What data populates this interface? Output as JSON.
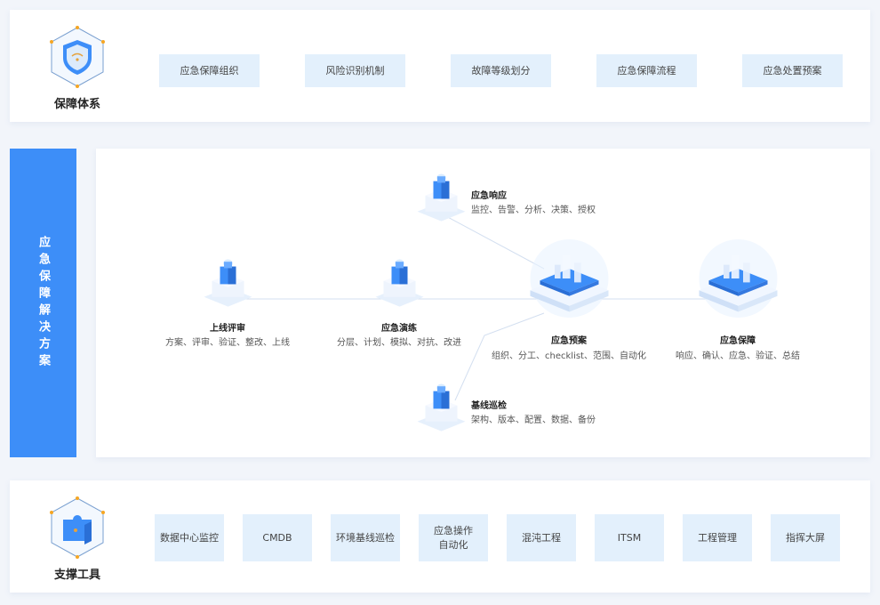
{
  "top": {
    "title": "保障体系",
    "icon": "shield-icon",
    "items": [
      "应急保障组织",
      "风险识别机制",
      "故障等级划分",
      "应急保障流程",
      "应急处置预案"
    ]
  },
  "middle": {
    "sidebar_label": "应急保障解决方案",
    "nodes": [
      {
        "title": "上线评审",
        "sub": "方案、评审、验证、整改、上线"
      },
      {
        "title": "应急演练",
        "sub": "分层、计划、模拟、对抗、改进"
      },
      {
        "title": "应急响应",
        "sub": "监控、告警、分析、决策、授权"
      },
      {
        "title": "应急预案",
        "sub": "组织、分工、checklist、范围、自动化"
      },
      {
        "title": "应急保障",
        "sub": "响应、确认、应急、验证、总结"
      },
      {
        "title": "基线巡检",
        "sub": "架构、版本、配置、数据、备份"
      }
    ]
  },
  "bottom": {
    "title": "支撑工具",
    "icon": "puzzle-icon",
    "items": [
      "数据中心监控",
      "CMDB",
      "环境基线巡检",
      "应急操作\n自动化",
      "混沌工程",
      "ITSM",
      "工程管理",
      "指挥大屏"
    ]
  },
  "colors": {
    "accent": "#3d8ef8",
    "chip": "#e3f0fc",
    "background": "#f2f5fa"
  }
}
